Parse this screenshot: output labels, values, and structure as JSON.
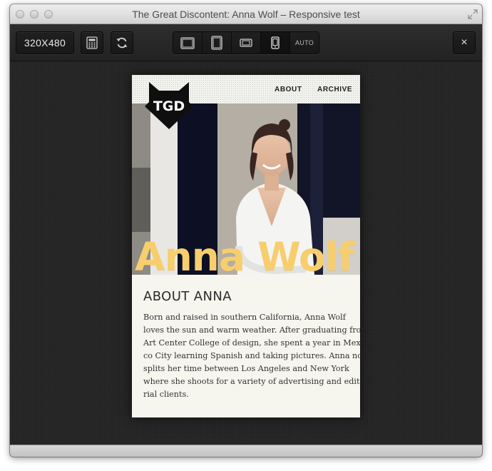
{
  "window": {
    "title": "The Great Discontent: Anna Wolf – Responsive test"
  },
  "toolbar": {
    "size_label": "320X480",
    "auto_label": "AUTO",
    "close_label": "×"
  },
  "icons": {
    "calc": "calculator-icon",
    "refresh": "refresh-icon",
    "desktop": "desktop-icon",
    "tablet": "tablet-icon",
    "landscape": "phone-landscape-icon",
    "portrait": "phone-portrait-icon",
    "fullscreen": "fullscreen-icon"
  },
  "site": {
    "logo_text": "TGD",
    "nav": {
      "about": "ABOUT",
      "archive": "ARCHIVE"
    },
    "hero_name": "Anna Wolf",
    "section_heading": "ABOUT ANNA",
    "bio_lines": [
      "Born and raised in southern California, Anna Wolf",
      "loves the sun and warm weather. After graduating from",
      "Art Center College of design, she spent a year in Mexi-",
      "co City learning Spanish and taking pictures. Anna now",
      "splits her time between Los Angeles and New York",
      "where she shoots for a variety of advertising and edito-",
      "rial clients."
    ]
  },
  "colors": {
    "accent_yellow": "#f7ce6e",
    "toolbar_bg": "#222222",
    "stage_bg": "#262626",
    "page_bg": "#f6f5ee"
  }
}
